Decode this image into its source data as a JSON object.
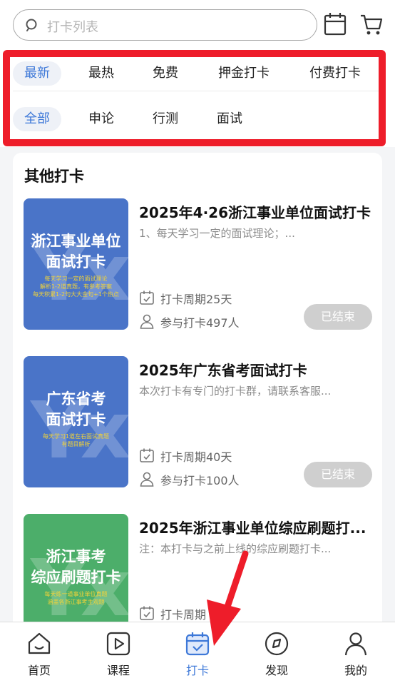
{
  "search": {
    "placeholder": "打卡列表"
  },
  "header_icons": [
    "calendar-icon",
    "cart-icon"
  ],
  "filters": {
    "row1": [
      {
        "label": "最新",
        "active": true
      },
      {
        "label": "最热",
        "active": false
      },
      {
        "label": "免费",
        "active": false
      },
      {
        "label": "押金打卡",
        "active": false
      },
      {
        "label": "付费打卡",
        "active": false
      }
    ],
    "row2": [
      {
        "label": "全部",
        "active": true
      },
      {
        "label": "申论",
        "active": false
      },
      {
        "label": "行测",
        "active": false
      },
      {
        "label": "面试",
        "active": false
      }
    ]
  },
  "section": {
    "title": "其他打卡"
  },
  "items": [
    {
      "title": "2025年4·26浙江事业单位面试打卡",
      "desc": "1、每天学习一定的面试理论；...",
      "period": "打卡周期25天",
      "participants": "参与打卡497人",
      "status": "已结束",
      "cover": {
        "color": "#4a74c8",
        "title_lines": [
          "浙江事业单位",
          "面试打卡"
        ],
        "sub_lines": [
          "每天学习一定的面试理论",
          "解析1-2道真题，有参考答案",
          "每天积累1-2句大大金句+1个热点"
        ]
      }
    },
    {
      "title": "2025年广东省考面试打卡",
      "desc": "本次打卡有专门的打卡群，请联系客服...",
      "period": "打卡周期40天",
      "participants": "参与打卡100人",
      "status": "已结束",
      "cover": {
        "color": "#4a74c8",
        "title_lines": [
          "广东省考",
          "面试打卡"
        ],
        "sub_lines": [
          "每天学习1道左右面试真题",
          "有题目解析"
        ]
      }
    },
    {
      "title": "2025年浙江事业单位综应刷题打...",
      "desc": "注：本打卡与之前上线的综应刷题打卡...",
      "period": "打卡周期",
      "participants": "",
      "status": "",
      "cover": {
        "color": "#4cae6a",
        "title_lines": [
          "浙江事考",
          "综应刷题打卡"
        ],
        "sub_lines": [
          "每天练一道事业单位真题",
          "涵盖各浙江事考主观题"
        ]
      }
    }
  ],
  "tabs": [
    {
      "label": "首页",
      "icon": "home-icon",
      "active": false
    },
    {
      "label": "课程",
      "icon": "play-icon",
      "active": false
    },
    {
      "label": "打卡",
      "icon": "calendar-check-icon",
      "active": true
    },
    {
      "label": "发现",
      "icon": "compass-icon",
      "active": false
    },
    {
      "label": "我的",
      "icon": "user-icon",
      "active": false
    }
  ],
  "colors": {
    "accent": "#3d78d8",
    "highlight_box": "#ee1d2a",
    "ended_badge": "#cfcfcf",
    "annotation_arrow": "#ee1d2a"
  }
}
